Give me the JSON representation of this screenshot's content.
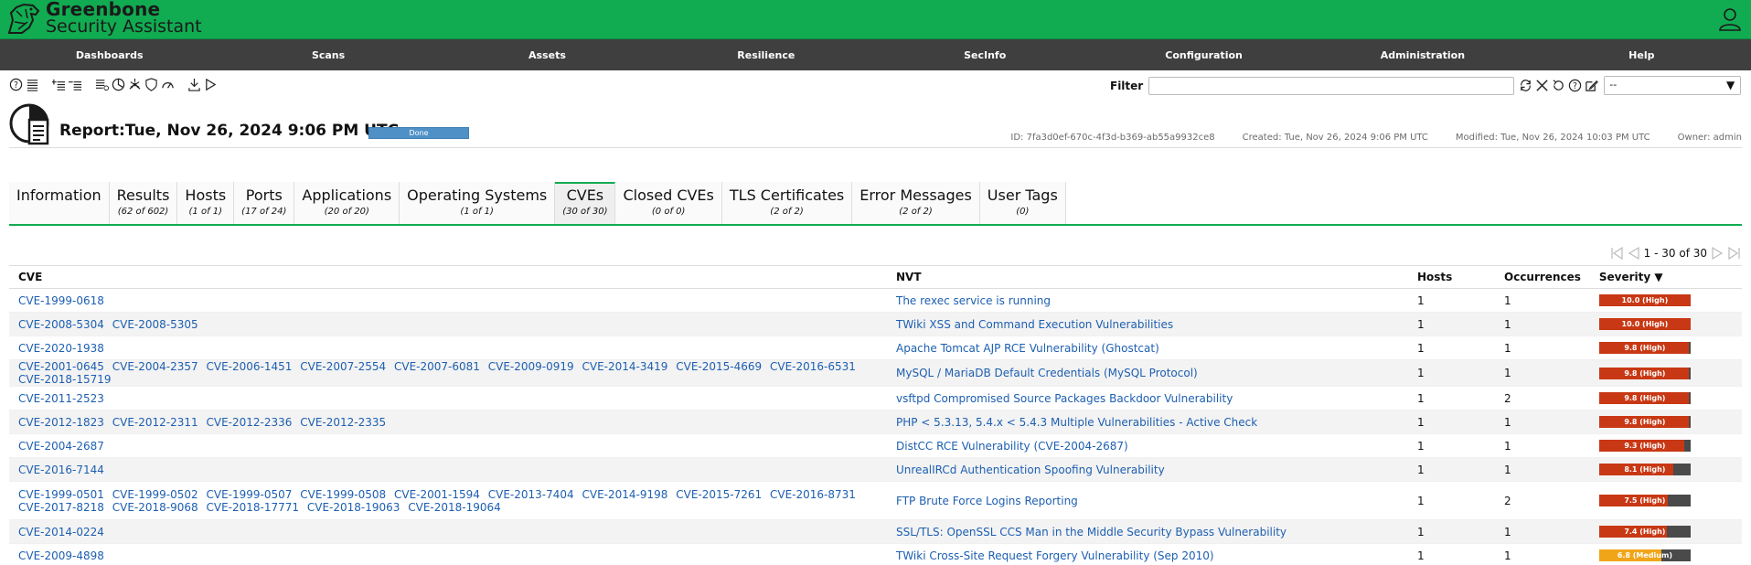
{
  "app": {
    "brand_line1": "Greenbone",
    "brand_line2": "Security Assistant",
    "accent_color": "#11ab51",
    "nav_color": "#3f3f3f"
  },
  "nav": [
    "Dashboards",
    "Scans",
    "Assets",
    "Resilience",
    "SecInfo",
    "Configuration",
    "Administration",
    "Help"
  ],
  "filter": {
    "label": "Filter",
    "value": "",
    "select_value": "--"
  },
  "report": {
    "title": "Report:Tue, Nov 26, 2024 9:06 PM UTC",
    "status": "Done",
    "id": "ID: 7fa3d0ef-670c-4f3d-b369-ab55a9932ce8",
    "created": "Created: Tue, Nov 26, 2024 9:06 PM UTC",
    "modified": "Modified: Tue, Nov 26, 2024 10:03 PM UTC",
    "owner": "Owner: admin"
  },
  "tabs": [
    {
      "label": "Information",
      "count": ""
    },
    {
      "label": "Results",
      "count": "(62 of 602)"
    },
    {
      "label": "Hosts",
      "count": "(1 of 1)"
    },
    {
      "label": "Ports",
      "count": "(17 of 24)"
    },
    {
      "label": "Applications",
      "count": "(20 of 20)"
    },
    {
      "label": "Operating Systems",
      "count": "(1 of 1)"
    },
    {
      "label": "CVEs",
      "count": "(30 of 30)"
    },
    {
      "label": "Closed CVEs",
      "count": "(0 of 0)"
    },
    {
      "label": "TLS Certificates",
      "count": "(2 of 2)"
    },
    {
      "label": "Error Messages",
      "count": "(2 of 2)"
    },
    {
      "label": "User Tags",
      "count": "(0)"
    }
  ],
  "active_tab": "CVEs",
  "pagination": {
    "text": "1 - 30 of 30"
  },
  "table": {
    "headers": {
      "cve": "CVE",
      "nvt": "NVT",
      "hosts": "Hosts",
      "occurrences": "Occurrences",
      "severity": "Severity ▼"
    },
    "rows": [
      {
        "cves": [
          "CVE-1999-0618"
        ],
        "nvt": "The rexec service is running",
        "hosts": "1",
        "occurrences": "1",
        "severity": 10.0,
        "severity_label": "10.0 (High)"
      },
      {
        "cves": [
          "CVE-2008-5304",
          "CVE-2008-5305"
        ],
        "nvt": "TWiki XSS and Command Execution Vulnerabilities",
        "hosts": "1",
        "occurrences": "1",
        "severity": 10.0,
        "severity_label": "10.0 (High)"
      },
      {
        "cves": [
          "CVE-2020-1938"
        ],
        "nvt": "Apache Tomcat AJP RCE Vulnerability (Ghostcat)",
        "hosts": "1",
        "occurrences": "1",
        "severity": 9.8,
        "severity_label": "9.8 (High)"
      },
      {
        "cves": [
          "CVE-2001-0645",
          "CVE-2004-2357",
          "CVE-2006-1451",
          "CVE-2007-2554",
          "CVE-2007-6081",
          "CVE-2009-0919",
          "CVE-2014-3419",
          "CVE-2015-4669",
          "CVE-2016-6531",
          "CVE-2018-15719"
        ],
        "nvt": "MySQL / MariaDB Default Credentials (MySQL Protocol)",
        "hosts": "1",
        "occurrences": "1",
        "severity": 9.8,
        "severity_label": "9.8 (High)"
      },
      {
        "cves": [
          "CVE-2011-2523"
        ],
        "nvt": "vsftpd Compromised Source Packages Backdoor Vulnerability",
        "hosts": "1",
        "occurrences": "2",
        "severity": 9.8,
        "severity_label": "9.8 (High)"
      },
      {
        "cves": [
          "CVE-2012-1823",
          "CVE-2012-2311",
          "CVE-2012-2336",
          "CVE-2012-2335"
        ],
        "nvt": "PHP < 5.3.13, 5.4.x < 5.4.3 Multiple Vulnerabilities - Active Check",
        "hosts": "1",
        "occurrences": "1",
        "severity": 9.8,
        "severity_label": "9.8 (High)"
      },
      {
        "cves": [
          "CVE-2004-2687"
        ],
        "nvt": "DistCC RCE Vulnerability (CVE-2004-2687)",
        "hosts": "1",
        "occurrences": "1",
        "severity": 9.3,
        "severity_label": "9.3 (High)"
      },
      {
        "cves": [
          "CVE-2016-7144"
        ],
        "nvt": "UnrealIRCd Authentication Spoofing Vulnerability",
        "hosts": "1",
        "occurrences": "1",
        "severity": 8.1,
        "severity_label": "8.1 (High)"
      },
      {
        "cves": [
          "CVE-1999-0501",
          "CVE-1999-0502",
          "CVE-1999-0507",
          "CVE-1999-0508",
          "CVE-2001-1594",
          "CVE-2013-7404",
          "CVE-2014-9198",
          "CVE-2015-7261",
          "CVE-2016-8731",
          "CVE-2017-8218",
          "CVE-2018-9068",
          "CVE-2018-17771",
          "CVE-2018-19063",
          "CVE-2018-19064"
        ],
        "nvt": "FTP Brute Force Logins Reporting",
        "hosts": "1",
        "occurrences": "2",
        "severity": 7.5,
        "severity_label": "7.5 (High)"
      },
      {
        "cves": [
          "CVE-2014-0224"
        ],
        "nvt": "SSL/TLS: OpenSSL CCS Man in the Middle Security Bypass Vulnerability",
        "hosts": "1",
        "occurrences": "1",
        "severity": 7.4,
        "severity_label": "7.4 (High)"
      },
      {
        "cves": [
          "CVE-2009-4898"
        ],
        "nvt": "TWiki Cross-Site Request Forgery Vulnerability (Sep 2010)",
        "hosts": "1",
        "occurrences": "1",
        "severity": 6.8,
        "severity_label": "6.8 (Medium)"
      }
    ]
  },
  "colors": {
    "high": "#c83814",
    "medium": "#f0a519",
    "link": "#1d5fb1",
    "status": "#4f91c7"
  }
}
